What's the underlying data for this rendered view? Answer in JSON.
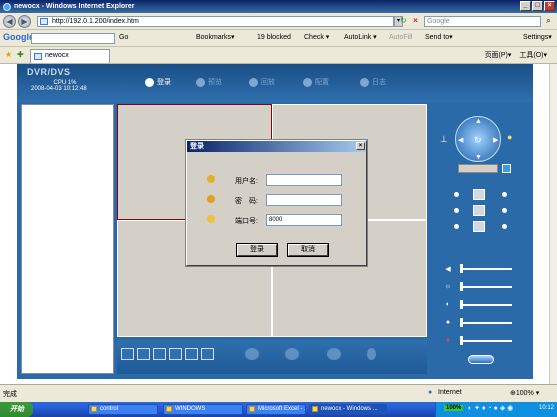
{
  "window": {
    "title": "newocx - Windows Internet Explorer",
    "min": "_",
    "max": "□",
    "close": "×"
  },
  "address_bar": {
    "back": "◀",
    "forward": "▶",
    "url": "http://192.0.1.200/index.htm",
    "dropdown": "▾",
    "refresh": "↻",
    "stop": "×",
    "search_placeholder": "Google",
    "search_go": "⌕"
  },
  "google_toolbar": {
    "logo": "Google",
    "go": "Go",
    "bookmarks": "Bookmarks▾",
    "blocked": "19 blocked",
    "check": "Check ▾",
    "autolink": "AutoLink ▾",
    "autofill": "AutoFill",
    "sendto": "Send to▾",
    "settings": "Settings▾"
  },
  "tabbar": {
    "tab_label": "newocx",
    "page_menu": "页面(P)▾",
    "tools_menu": "工具(O)▾"
  },
  "dvr": {
    "title": "DVR/DVS",
    "cpu": "CPU 1%",
    "datetime": "2008-04-03 10:12:48",
    "menu": [
      {
        "label": "登录",
        "color": "#ffffff"
      },
      {
        "label": "预览",
        "color": "#7fa6cf"
      },
      {
        "label": "回放",
        "color": "#7fa6cf"
      },
      {
        "label": "配置",
        "color": "#7fa6cf"
      },
      {
        "label": "日志",
        "color": "#7fa6cf"
      }
    ],
    "preset": ""
  },
  "login_dialog": {
    "title": "登录",
    "close": "×",
    "username_label": "用户名:",
    "username_value": "",
    "password_label": "密　码:",
    "password_value": "",
    "port_label": "端口号:",
    "port_value": "8000",
    "login_button": "登录",
    "cancel_button": "取消"
  },
  "statusbar": {
    "text": "完成",
    "zone": "Internet",
    "zoom": "⊕100% ▾"
  },
  "taskbar": {
    "start": "开始",
    "tasks": [
      {
        "label": "control"
      },
      {
        "label": "WINDOWS"
      },
      {
        "label": "Microsoft Excel - ..."
      },
      {
        "label": "newocx - Windows ..."
      }
    ],
    "battery": "100%",
    "time": "10:12"
  },
  "colors": {
    "accent": "#2a6aa8",
    "highlight_red": "#8b0000"
  }
}
